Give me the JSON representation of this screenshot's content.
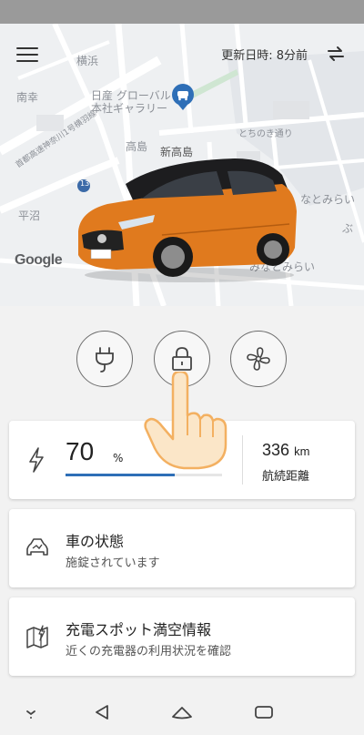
{
  "header": {
    "updated_label": "更新日時: 8分前",
    "menu_icon": "menu-icon",
    "refresh_icon": "refresh-icon"
  },
  "map": {
    "labels": {
      "yokohama": "横浜",
      "nankou": "南幸",
      "nissan_hq": "日産 グローバル\n本社ギャラリー",
      "takashima": "高島",
      "shin_takashima": "新高島",
      "tochinoki": "とちのき通り",
      "hiranuma": "平沼",
      "minatomirai_right": "なとみらい",
      "minatomirai_bottom": "みなとみらい",
      "expressway": "首都高速神奈川1号横羽線",
      "route13": "13",
      "bu": "ぶ"
    },
    "attribution": "Google"
  },
  "controls": [
    {
      "name": "charge-button",
      "icon": "plug-icon"
    },
    {
      "name": "lock-button",
      "icon": "lock-icon"
    },
    {
      "name": "climate-button",
      "icon": "fan-icon"
    }
  ],
  "battery": {
    "percent": "70",
    "percent_unit": "%",
    "level_fraction": 0.7,
    "range_value": "336",
    "range_unit": "km",
    "range_label": "航続距離"
  },
  "status_card": {
    "title": "車の状態",
    "subtitle": "施錠されています"
  },
  "spot_card": {
    "title": "充電スポット満空情報",
    "subtitle": "近くの充電器の利用状況を確認"
  },
  "colors": {
    "accent_blue": "#2e6fb7",
    "car_orange": "#e07a1e"
  }
}
